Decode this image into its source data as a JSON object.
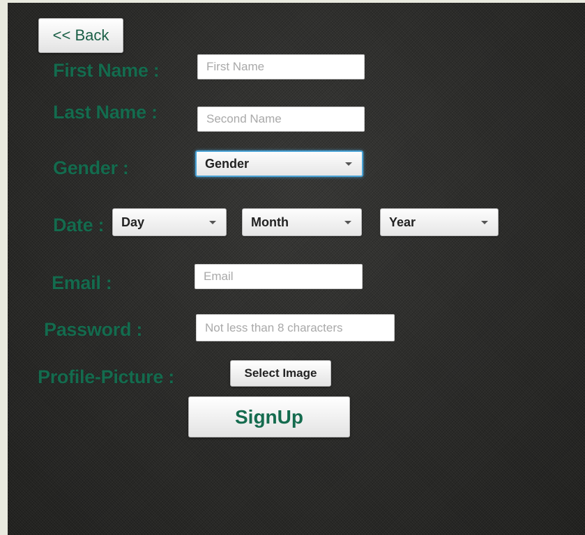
{
  "theme": {
    "label_color": "#146b4e",
    "background_color": "#2c2c2a",
    "focus_color": "#4aa3d6"
  },
  "back_button": {
    "label": "<< Back"
  },
  "form": {
    "first_name": {
      "label": "First Name :",
      "placeholder": "First Name",
      "value": ""
    },
    "last_name": {
      "label": "Last Name :",
      "placeholder": "Second Name",
      "value": ""
    },
    "gender": {
      "label": "Gender :",
      "selected": "Gender"
    },
    "date": {
      "label": "Date :",
      "day_selected": "Day",
      "month_selected": "Month",
      "year_selected": "Year"
    },
    "email": {
      "label": "Email :",
      "placeholder": "Email",
      "value": ""
    },
    "password": {
      "label": "Password :",
      "placeholder": "Not less than 8 characters",
      "value": ""
    },
    "profile_picture": {
      "label": "Profile-Picture :",
      "button_label": "Select Image"
    },
    "submit": {
      "label": "SignUp"
    }
  },
  "icons": {
    "dropdown": "chevron-down-icon"
  }
}
